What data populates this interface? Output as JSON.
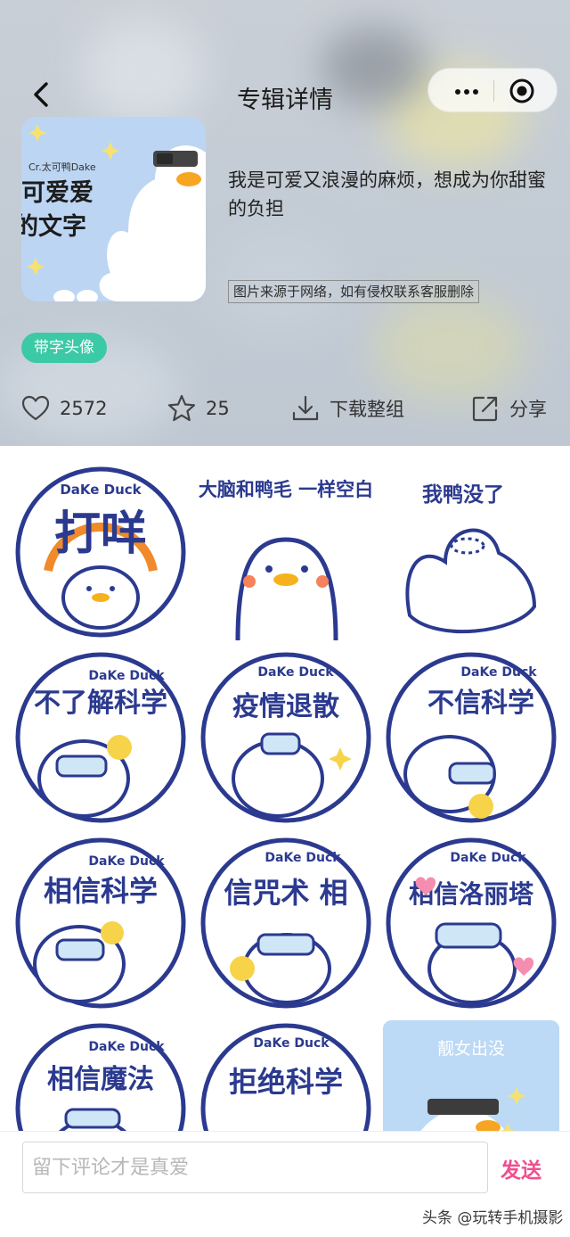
{
  "header": {
    "title": "专辑详情"
  },
  "album": {
    "cover_lines": [
      "Cr.太可鸭Dake",
      "可爱爱",
      "的文字"
    ],
    "description": "我是可爱又浪漫的麻烦，想成为你甜蜜的负担",
    "source_note": "图片来源于网络，如有侵权联系客服删除",
    "tag": "带字头像"
  },
  "actions": {
    "likes": "2572",
    "favorites": "25",
    "download_label": "下载整组",
    "share_label": "分享"
  },
  "grid": {
    "tiles": [
      {
        "badge": "DaKe Duck",
        "text": "打咩"
      },
      {
        "text": "大脑和鸭毛 一样空白"
      },
      {
        "text": "我鸭没了"
      },
      {
        "badge": "DaKe Duck",
        "text": "不了解科学"
      },
      {
        "badge": "DaKe Duck",
        "text": "疫情退散"
      },
      {
        "badge": "DaKe Duck",
        "text": "不信科学"
      },
      {
        "badge": "DaKe Duck",
        "text": "相信科学"
      },
      {
        "badge": "DaKe Duck",
        "text": "信咒术 相"
      },
      {
        "badge": "DaKe Duck",
        "text": "相信洛丽塔"
      },
      {
        "badge": "DaKe Duck",
        "text": "相信魔法"
      },
      {
        "badge": "DaKe Duck",
        "text": "拒绝科学"
      },
      {
        "text": "靓女出没"
      }
    ]
  },
  "comment": {
    "placeholder": "留下评论才是真爱",
    "send_label": "发送"
  },
  "watermark": "头条 @玩转手机摄影",
  "colors": {
    "tag_bg": "#3cc9a6",
    "send": "#ef4f8f",
    "sticker_navy": "#2b3a8f",
    "sticker_orange": "#f08a2a"
  }
}
